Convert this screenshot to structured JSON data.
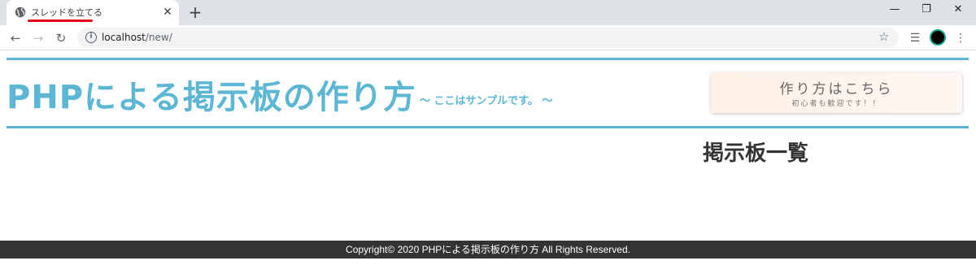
{
  "browser": {
    "tab": {
      "title": "スレッドを立てる",
      "close": "✕"
    },
    "new_tab": "+",
    "window": {
      "minimize": "—",
      "restore": "❐",
      "close": "✕"
    },
    "nav": {
      "back": "←",
      "forward": "→",
      "reload": "↻"
    },
    "address": {
      "host": "localhost",
      "path": "/new/"
    },
    "icons": [
      "info-icon",
      "star-icon",
      "reading-list-icon",
      "avatar-icon",
      "menu-icon"
    ]
  },
  "page": {
    "site_title": "PHPによる掲示板の作り方",
    "site_subtitle": "～ ここはサンプルです。 ～",
    "howto": {
      "main": "作り方はこちら",
      "sub": "初心者も歓迎です！！"
    },
    "board_heading": "掲示板一覧",
    "footer": "Copyright© 2020 PHPによる掲示板の作り方 All Rights Reserved."
  },
  "colors": {
    "accent": "#5bb7d4",
    "footer_bg": "#333333",
    "tab_underline": "#e0001b"
  }
}
